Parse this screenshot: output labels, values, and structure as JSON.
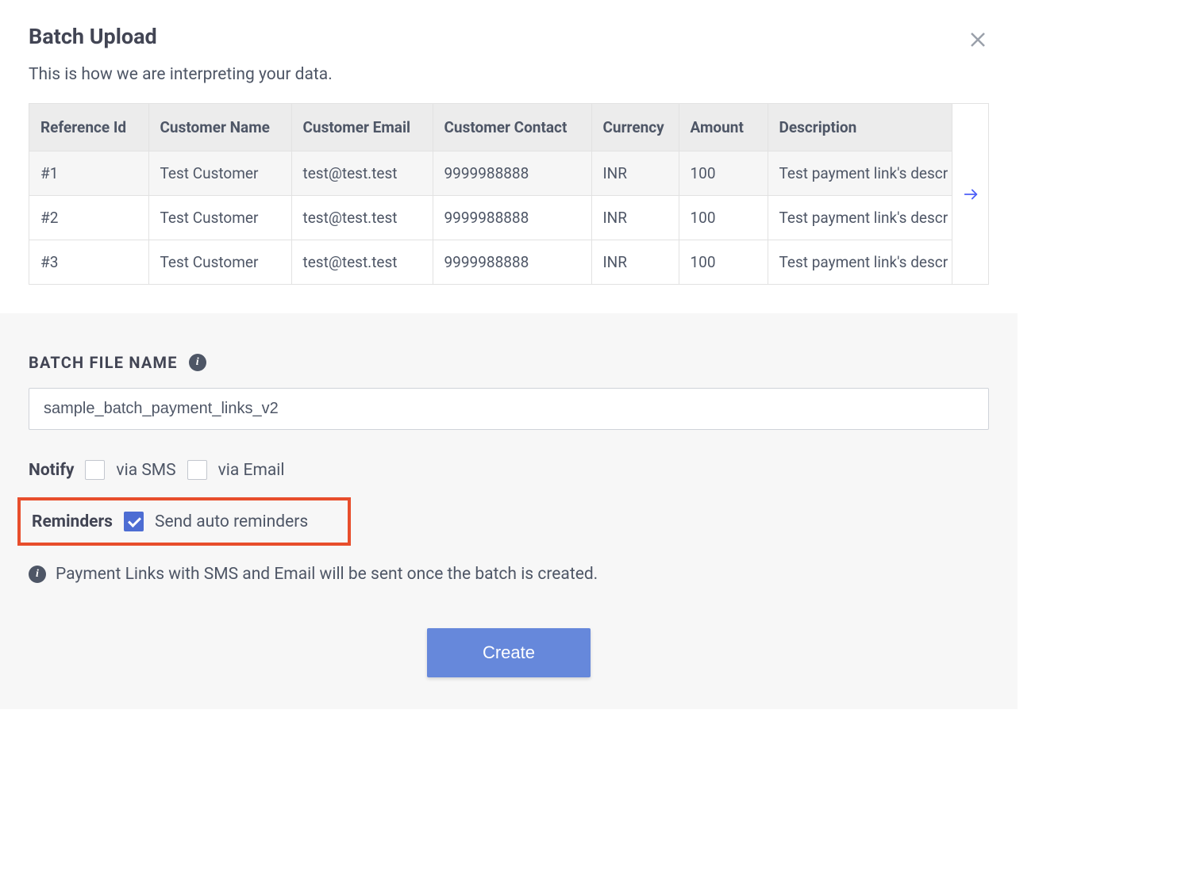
{
  "header": {
    "title": "Batch Upload",
    "subtitle": "This is how we are interpreting your data."
  },
  "table": {
    "columns": [
      "Reference Id",
      "Customer Name",
      "Customer Email",
      "Customer Contact",
      "Currency",
      "Amount",
      "Description"
    ],
    "rows": [
      {
        "reference_id": "#1",
        "customer_name": "Test Customer",
        "customer_email": "test@test.test",
        "customer_contact": "9999988888",
        "currency": "INR",
        "amount": "100",
        "description": "Test payment link's descr"
      },
      {
        "reference_id": "#2",
        "customer_name": "Test Customer",
        "customer_email": "test@test.test",
        "customer_contact": "9999988888",
        "currency": "INR",
        "amount": "100",
        "description": "Test payment link's descr"
      },
      {
        "reference_id": "#3",
        "customer_name": "Test Customer",
        "customer_email": "test@test.test",
        "customer_contact": "9999988888",
        "currency": "INR",
        "amount": "100",
        "description": "Test payment link's descr"
      }
    ]
  },
  "form": {
    "batch_file_label": "BATCH FILE NAME",
    "batch_file_value": "sample_batch_payment_links_v2",
    "notify_label": "Notify",
    "via_sms_label": "via SMS",
    "via_email_label": "via Email",
    "reminders_label": "Reminders",
    "reminders_text": "Send auto reminders",
    "info_text": "Payment Links with SMS and Email will be sent once the batch is created.",
    "create_button": "Create"
  }
}
